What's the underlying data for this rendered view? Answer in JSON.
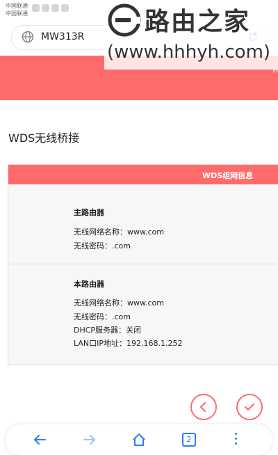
{
  "status_bar": {
    "carrier_1": "中国联通",
    "carrier_2": "中国联通"
  },
  "browser": {
    "url": "MW313R"
  },
  "watermark": {
    "title": "路由之家",
    "url": "(www.hhhyh.com)"
  },
  "header": {
    "corner_text": "H"
  },
  "page": {
    "title": "WDS无线桥接"
  },
  "card": {
    "header": "WDS组网信息",
    "primary_router": {
      "title": "主路由器",
      "ssid_label": "无线网络名称：",
      "ssid_value": "www.com",
      "password_label": "无线密码：",
      "password_value": ".com"
    },
    "this_router": {
      "title": "本路由器",
      "ssid_label": "无线网络名称：",
      "ssid_value": "www.com",
      "password_label": "无线密码：",
      "password_value": ".com",
      "dhcp_label": "DHCP服务器：",
      "dhcp_value": "关闭",
      "lan_ip_label": "LAN口IP地址：",
      "lan_ip_value": "192.168.1.252"
    }
  },
  "actions": {
    "back_icon": "chevron-left-icon",
    "confirm_icon": "checkmark-icon"
  },
  "bottom_nav": {
    "tab_count": "2"
  },
  "colors": {
    "accent": "#ff6b6b",
    "nav_blue": "#2d7cf6"
  }
}
